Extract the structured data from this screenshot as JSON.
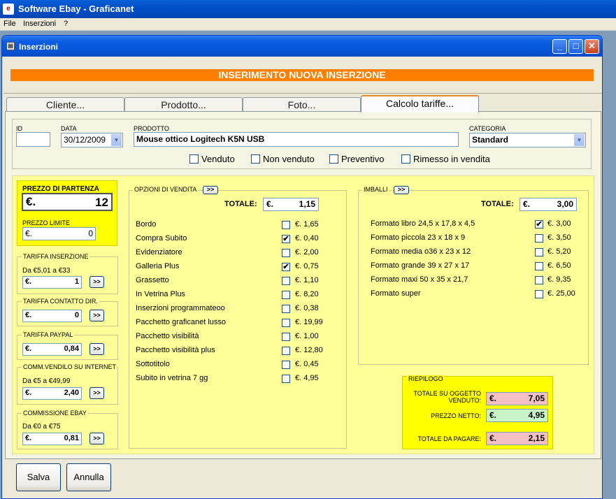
{
  "app": {
    "title": "Software Ebay - Graficanet"
  },
  "menu": [
    "File",
    "Inserzioni",
    "?"
  ],
  "window": {
    "title": "Inserzioni",
    "min": "_",
    "max": "□",
    "close": "✕"
  },
  "banner": "INSERIMENTO NUOVA INSERZIONE",
  "tabs": [
    "Cliente...",
    "Prodotto...",
    "Foto...",
    "Calcolo tariffe..."
  ],
  "fields": {
    "id_label": "ID",
    "id_value": "",
    "data_label": "DATA",
    "data_value": "30/12/2009",
    "prodotto_label": "PRODOTTO",
    "prodotto_value": "Mouse ottico Logitech K5N USB",
    "categoria_label": "CATEGORIA",
    "categoria_value": "Standard"
  },
  "status_checks": [
    {
      "label": "Venduto",
      "checked": false
    },
    {
      "label": "Non venduto",
      "checked": false
    },
    {
      "label": "Preventivo",
      "checked": false
    },
    {
      "label": "Rimesso in vendita",
      "checked": false
    }
  ],
  "currency": "€.",
  "prezzo_partenza": {
    "label": "PREZZO DI PARTENZA",
    "value": "12"
  },
  "prezzo_limite": {
    "label": "PREZZO LIMITE",
    "value": "0"
  },
  "tariffa_inserzione": {
    "label": "TARIFFA INSERZIONE",
    "range": "Da €5,01 a €33",
    "value": "1"
  },
  "tariffa_contatto": {
    "label": "TARIFFA CONTATTO DIR.",
    "value": "0"
  },
  "tariffa_paypal": {
    "label": "TARIFFA PAYPAL",
    "value": "0,84"
  },
  "comm_vendilo": {
    "label": "COMM.VENDILO SU INTERNET",
    "range": "Da €5 a €49,99",
    "value": "2,40"
  },
  "commissione_ebay": {
    "label": "COMMISSIONE EBAY",
    "range": "Da €0 a €75",
    "value": "0,81"
  },
  "detail_btn": ">>",
  "opzioni": {
    "title": "OPZIONI DI VENDITA",
    "totale_label": "TOTALE:",
    "totale": "1,15",
    "items": [
      {
        "name": "Bordo",
        "checked": false,
        "price": "€. 1,65"
      },
      {
        "name": "Compra Subito",
        "checked": true,
        "price": "€. 0,40"
      },
      {
        "name": "Evidenziatore",
        "checked": false,
        "price": "€. 2,00"
      },
      {
        "name": "Galleria Plus",
        "checked": true,
        "price": "€. 0,75"
      },
      {
        "name": "Grassetto",
        "checked": false,
        "price": "€. 1,10"
      },
      {
        "name": "In Vetrina Plus",
        "checked": false,
        "price": "€. 8,20"
      },
      {
        "name": "Inserzioni programmateoo",
        "checked": false,
        "price": "€. 0,38"
      },
      {
        "name": "Pacchetto graficanet lusso",
        "checked": false,
        "price": "€. 19,99"
      },
      {
        "name": "Pacchetto visibilità",
        "checked": false,
        "price": "€. 1,00"
      },
      {
        "name": "Pacchetto visibilità plus",
        "checked": false,
        "price": "€. 12,80"
      },
      {
        "name": "Sottotitolo",
        "checked": false,
        "price": "€. 0,45"
      },
      {
        "name": "Subito in vetrina 7 gg",
        "checked": false,
        "price": "€. 4,95"
      }
    ]
  },
  "imballi": {
    "title": "IMBALLI",
    "totale_label": "TOTALE:",
    "totale": "3,00",
    "items": [
      {
        "name": "Formato libro 24,5 x 17,8 x 4,5",
        "checked": true,
        "price": "€. 3,00"
      },
      {
        "name": "Formato piccola 23 x 18 x 9",
        "checked": false,
        "price": "€. 3,50"
      },
      {
        "name": "Formato media o36 x 23 x 12",
        "checked": false,
        "price": "€. 5,20"
      },
      {
        "name": "Formato grande 39 x 27 x 17",
        "checked": false,
        "price": "€. 6,50"
      },
      {
        "name": "Formato maxi 50 x 35 x 21,7",
        "checked": false,
        "price": "€. 9,35"
      },
      {
        "name": "Formato super",
        "checked": false,
        "price": "€. 25,00"
      }
    ]
  },
  "riepilogo": {
    "title": "RIEPILOGO",
    "totale_oggetto_label1": "TOTALE SU OGGETTO",
    "totale_oggetto_label2": "VENDUTO:",
    "totale_oggetto": "7,05",
    "prezzo_netto_label": "PREZZO NETTO:",
    "prezzo_netto": "4,95",
    "totale_pagare_label": "TOTALE DA PAGARE:",
    "totale_pagare": "2,15",
    "colors": {
      "pink": "#f4c0c4",
      "green": "#c8f4c8"
    }
  },
  "buttons": {
    "salva": "Salva",
    "annulla": "Annulla"
  }
}
